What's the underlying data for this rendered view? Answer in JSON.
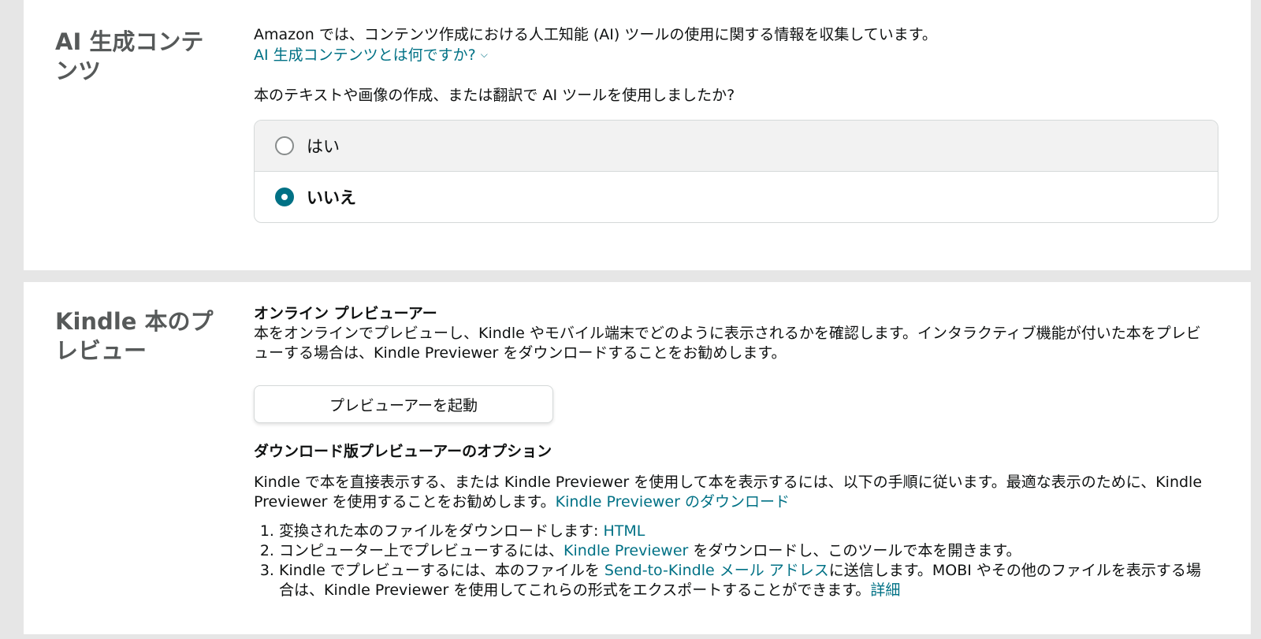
{
  "ai_section": {
    "title": "AI 生成コンテンツ",
    "intro": "Amazon では、コンテンツ作成における人工知能 (AI) ツールの使用に関する情報を収集しています。",
    "info_link": "AI 生成コンテンツとは何ですか?",
    "question": "本のテキストや画像の作成、または翻訳で AI ツールを使用しましたか?",
    "options": [
      {
        "label": "はい",
        "selected": false
      },
      {
        "label": "いいえ",
        "selected": true
      }
    ]
  },
  "preview_section": {
    "title": "Kindle 本のプレビュー",
    "online_heading": "オンライン プレビューアー",
    "online_desc": "本をオンラインでプレビューし、Kindle やモバイル端末でどのように表示されるかを確認します。インタラクティブ機能が付いた本をプレビューする場合は、Kindle Previewer をダウンロードすることをお勧めします。",
    "launch_button": "プレビューアーを起動",
    "download_heading": "ダウンロード版プレビューアーのオプション",
    "download_desc": "Kindle で本を直接表示する、または Kindle Previewer を使用して本を表示するには、以下の手順に従います。最適な表示のために、Kindle Previewer を使用することをお勧めします。",
    "download_link": "Kindle Previewer のダウンロード",
    "steps": [
      {
        "text": "変換された本のファイルをダウンロードします: ",
        "link": "HTML",
        "after": ""
      },
      {
        "text": "コンピューター上でプレビューするには、",
        "link": "Kindle Previewer",
        "after": " をダウンロードし、このツールで本を開きます。"
      },
      {
        "text": "Kindle でプレビューするには、本のファイルを ",
        "link": "Send-to-Kindle メール アドレス",
        "after": "に送信します。MOBI やその他のファイルを表示する場合は、Kindle Previewer を使用してこれらの形式をエクスポートすることができます。",
        "link2": "詳細"
      }
    ]
  },
  "colors": {
    "link": "#007185",
    "radio_selected": "#007185",
    "page_background": "#e6e6e6",
    "section_title": "#565959"
  },
  "icons": {
    "info_link_chevron": "chevron-down-icon"
  }
}
